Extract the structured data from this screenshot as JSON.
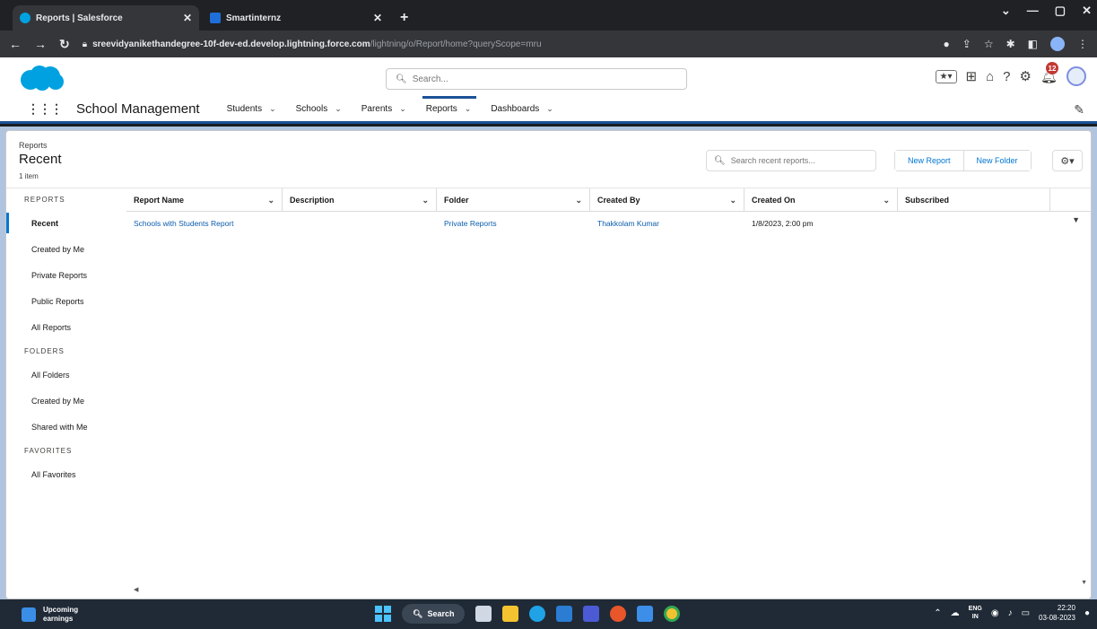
{
  "browser": {
    "tabs": [
      {
        "title": "Reports | Salesforce",
        "active": true,
        "favicon_color": "#00a1e0"
      },
      {
        "title": "Smartinternz",
        "active": false,
        "favicon_color": "#1e6fd9"
      }
    ],
    "url_domain": "sreevidyanikethandegree-10f-dev-ed.develop.lightning.force.com",
    "url_path": "/lightning/o/Report/home?queryScope=mru"
  },
  "sf_header": {
    "search_placeholder": "Search...",
    "notification_count": "12"
  },
  "app_nav": {
    "app_name": "School Management",
    "items": [
      {
        "label": "Students",
        "active": false
      },
      {
        "label": "Schools",
        "active": false
      },
      {
        "label": "Parents",
        "active": false
      },
      {
        "label": "Reports",
        "active": true
      },
      {
        "label": "Dashboards",
        "active": false
      }
    ]
  },
  "list_header": {
    "breadcrumb": "Reports",
    "title": "Recent",
    "count": "1 item",
    "search_placeholder": "Search recent reports...",
    "new_report": "New Report",
    "new_folder": "New Folder"
  },
  "sidebar": {
    "sections": [
      {
        "heading": "REPORTS",
        "items": [
          {
            "label": "Recent",
            "active": true
          },
          {
            "label": "Created by Me",
            "active": false
          },
          {
            "label": "Private Reports",
            "active": false
          },
          {
            "label": "Public Reports",
            "active": false
          },
          {
            "label": "All Reports",
            "active": false
          }
        ]
      },
      {
        "heading": "FOLDERS",
        "items": [
          {
            "label": "All Folders",
            "active": false
          },
          {
            "label": "Created by Me",
            "active": false
          },
          {
            "label": "Shared with Me",
            "active": false
          }
        ]
      },
      {
        "heading": "FAVORITES",
        "items": [
          {
            "label": "All Favorites",
            "active": false
          }
        ]
      }
    ]
  },
  "table": {
    "columns": [
      {
        "label": "Report Name",
        "sortable": true
      },
      {
        "label": "Description",
        "sortable": true
      },
      {
        "label": "Folder",
        "sortable": true
      },
      {
        "label": "Created By",
        "sortable": true
      },
      {
        "label": "Created On",
        "sortable": true
      },
      {
        "label": "Subscribed",
        "sortable": false
      }
    ],
    "rows": [
      {
        "report_name": "Schools with Students Report",
        "description": "",
        "folder": "Private Reports",
        "created_by": "Thakkolam Kumar",
        "created_on": "1/8/2023, 2:00 pm",
        "subscribed": ""
      }
    ]
  },
  "taskbar": {
    "weather_line1": "Upcoming",
    "weather_line2": "earnings",
    "search_label": "Search",
    "lang_line1": "ENG",
    "lang_line2": "IN",
    "time": "22:20",
    "date": "03-08-2023"
  }
}
